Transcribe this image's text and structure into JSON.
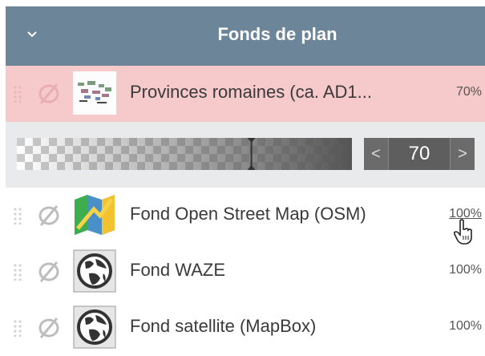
{
  "header": {
    "title": "Fonds de plan",
    "toggle_icon": "chevron-down-icon"
  },
  "layers": [
    {
      "name": "Provinces romaines (ca. AD1...",
      "opacity_label": "70%",
      "active": true,
      "thumb": "map-thumbnail"
    },
    {
      "name": "Fond Open Street Map (OSM)",
      "opacity_label": "100%",
      "thumb": "map-icon"
    },
    {
      "name": "Fond WAZE",
      "opacity_label": "100%",
      "thumb": "globe-icon"
    },
    {
      "name": "Fond satellite (MapBox)",
      "opacity_label": "100%",
      "thumb": "globe-icon"
    }
  ],
  "opacity_slider": {
    "value": "70",
    "fraction": 0.7,
    "prev": "<",
    "next": ">"
  },
  "colors": {
    "header": "#6c8599",
    "active_row": "#f6c9cb",
    "slider_row": "#e8eaec"
  }
}
